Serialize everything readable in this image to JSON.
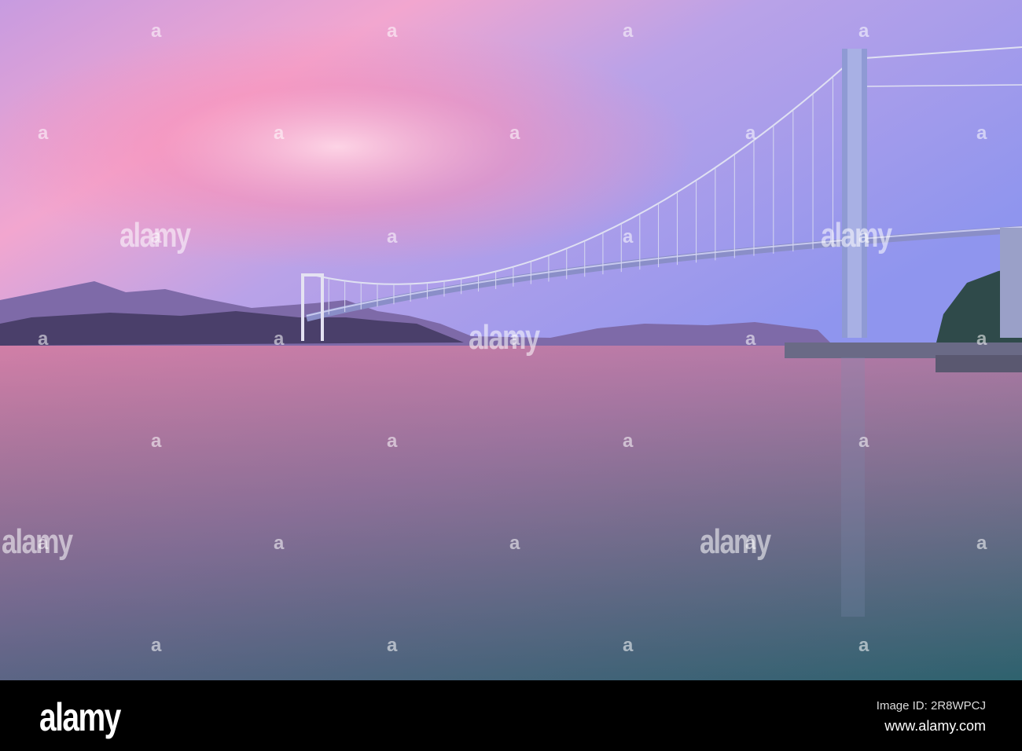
{
  "watermark": {
    "text": "alamy"
  },
  "footer": {
    "logo": "alamy",
    "image_id": "Image ID: 2R8WPCJ",
    "url": "www.alamy.com"
  },
  "colors": {
    "sky_top": "#9a8ee8",
    "sky_glow": "#f59ab8",
    "water_left": "#b06a9a",
    "water_right": "#3c6a78"
  }
}
